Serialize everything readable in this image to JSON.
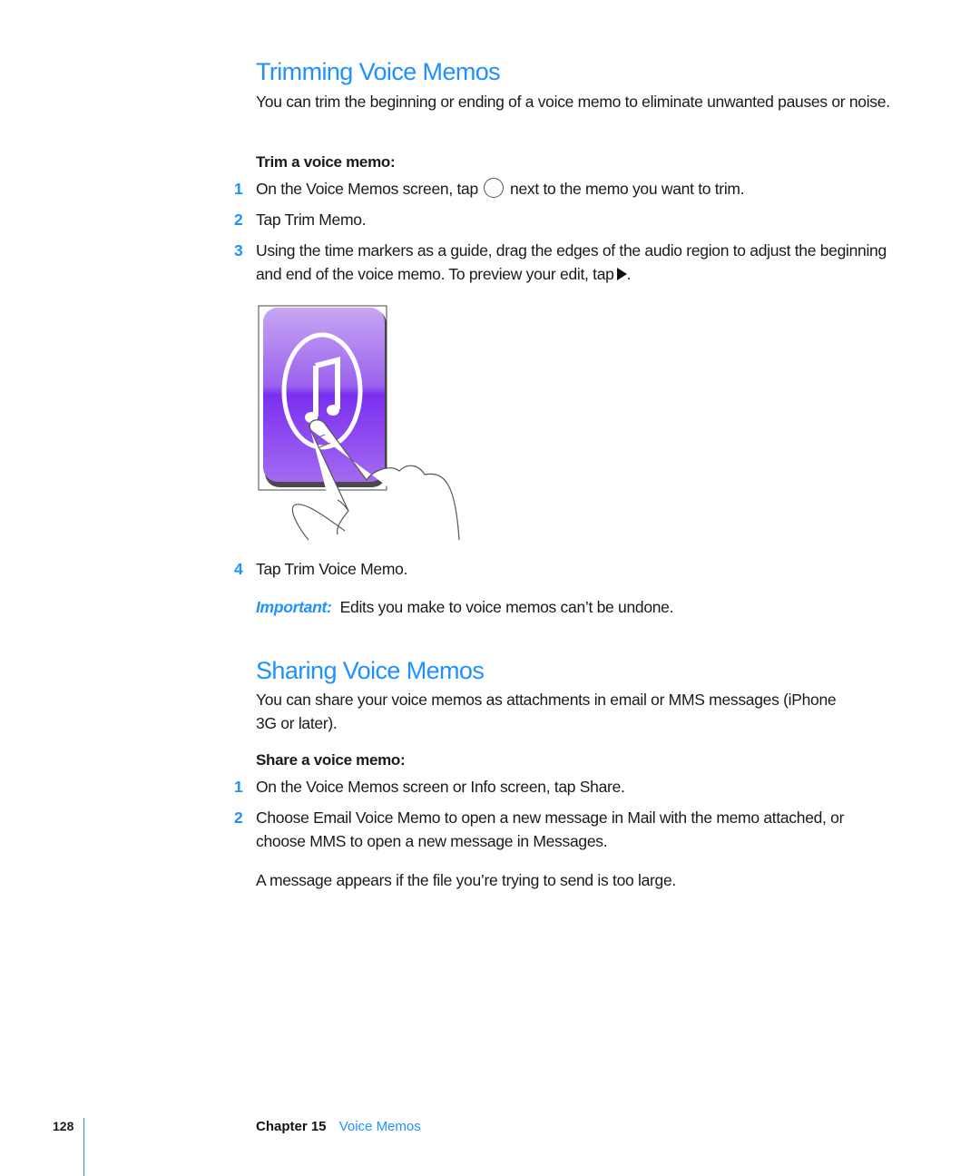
{
  "sections": [
    {
      "title": "Trimming Voice Memos",
      "intro": "You can trim the beginning or ending of a voice memo to eliminate unwanted pauses or noise.",
      "task_heading": "Trim a voice memo:",
      "steps": [
        {
          "num": "1",
          "text_before": "On the Voice Memos screen, tap",
          "icon": "circle-arrow-icon",
          "text_after": "next to the memo you want to trim."
        },
        {
          "num": "2",
          "text": "Tap Trim Memo."
        },
        {
          "num": "3",
          "text_before": "Using the time markers as a guide, drag the edges of the audio region to adjust the beginning and end of the voice memo. To preview your edit, tap",
          "icon": "play-icon",
          "text_after": "."
        },
        {
          "num": "4",
          "text": "Tap Trim Voice Memo."
        }
      ],
      "illustration": {
        "icon": "itunes-music-note-icon",
        "gesture": "finger-tap-icon",
        "colors": {
          "icon_purple": "#8a3ff0",
          "icon_light": "#c59cf5"
        }
      },
      "note": {
        "label": "Important:",
        "text": "Edits you make to voice memos can’t be undone."
      }
    },
    {
      "title": "Sharing Voice Memos",
      "intro": "You can share your voice memos as attachments in email or MMS messages (iPhone 3G or later).",
      "task_heading": "Share a voice memo:",
      "steps": [
        {
          "num": "1",
          "text": "On the Voice Memos screen or Info screen, tap Share."
        },
        {
          "num": "2",
          "text": "Choose Email Voice Memo to open a new message in Mail with the memo attached, or choose MMS to open a new message in Messages."
        }
      ],
      "outro": "A message appears if the file you’re trying to send is too large."
    }
  ],
  "footer": {
    "page_number": "128",
    "chapter_label": "Chapter 15",
    "chapter_title": "Voice Memos"
  },
  "colors": {
    "accent": "#1e90ff",
    "text": "#1a1a1a"
  }
}
